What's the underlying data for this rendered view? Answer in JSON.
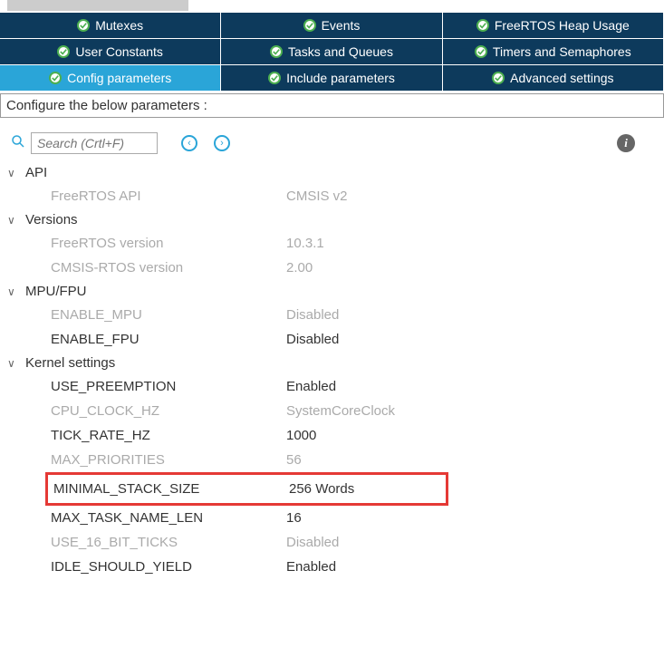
{
  "tabs": {
    "row1": [
      {
        "label": "Mutexes"
      },
      {
        "label": "Events"
      },
      {
        "label": "FreeRTOS Heap Usage"
      }
    ],
    "row2": [
      {
        "label": "User Constants"
      },
      {
        "label": "Tasks and Queues"
      },
      {
        "label": "Timers and Semaphores"
      }
    ],
    "row3": [
      {
        "label": "Config parameters"
      },
      {
        "label": "Include parameters"
      },
      {
        "label": "Advanced settings"
      }
    ]
  },
  "instruction": "Configure the below parameters :",
  "search": {
    "placeholder": "Search (Crtl+F)"
  },
  "groups": [
    {
      "name": "API",
      "items": [
        {
          "label": "FreeRTOS API",
          "value": "CMSIS v2",
          "muted": true
        }
      ]
    },
    {
      "name": "Versions",
      "items": [
        {
          "label": "FreeRTOS version",
          "value": "10.3.1",
          "muted": true
        },
        {
          "label": "CMSIS-RTOS version",
          "value": "2.00",
          "muted": true
        }
      ]
    },
    {
      "name": "MPU/FPU",
      "items": [
        {
          "label": "ENABLE_MPU",
          "value": "Disabled",
          "muted": true
        },
        {
          "label": "ENABLE_FPU",
          "value": "Disabled",
          "muted": false
        }
      ]
    },
    {
      "name": "Kernel settings",
      "items": [
        {
          "label": "USE_PREEMPTION",
          "value": "Enabled",
          "muted": false
        },
        {
          "label": "CPU_CLOCK_HZ",
          "value": "SystemCoreClock",
          "muted": true
        },
        {
          "label": "TICK_RATE_HZ",
          "value": "1000",
          "muted": false
        },
        {
          "label": "MAX_PRIORITIES",
          "value": "56",
          "muted": true
        },
        {
          "label": "MINIMAL_STACK_SIZE",
          "value": "256 Words",
          "muted": false,
          "highlight": true
        },
        {
          "label": "MAX_TASK_NAME_LEN",
          "value": "16",
          "muted": false
        },
        {
          "label": "USE_16_BIT_TICKS",
          "value": "Disabled",
          "muted": true
        },
        {
          "label": "IDLE_SHOULD_YIELD",
          "value": "Enabled",
          "muted": false
        }
      ]
    }
  ]
}
